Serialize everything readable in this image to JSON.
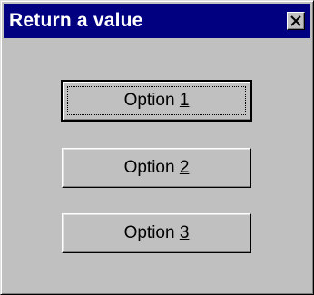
{
  "window": {
    "title": "Return a value"
  },
  "titlebar": {
    "close_icon": "close-icon"
  },
  "buttons": [
    {
      "prefix": "Option ",
      "hotkey": "1",
      "default": true,
      "focused": true
    },
    {
      "prefix": "Option ",
      "hotkey": "2",
      "default": false,
      "focused": false
    },
    {
      "prefix": "Option ",
      "hotkey": "3",
      "default": false,
      "focused": false
    }
  ],
  "colors": {
    "titlebar_bg": "#000080",
    "titlebar_text": "#ffffff",
    "face": "#c0c0c0"
  }
}
